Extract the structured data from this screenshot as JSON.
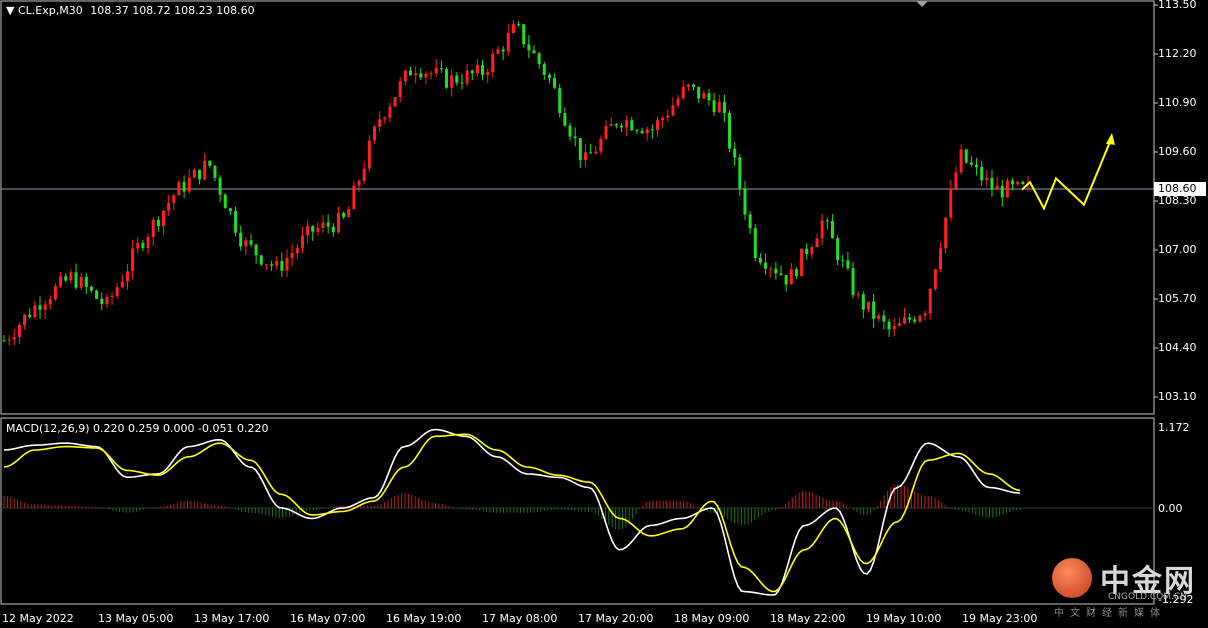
{
  "header": {
    "symbol": "CL.Exp,M30",
    "ohlc": "108.37 108.72 108.23 108.60"
  },
  "price_axis": {
    "ticks": [
      "113.50",
      "112.20",
      "110.90",
      "109.60",
      "108.30",
      "107.00",
      "105.70",
      "104.40",
      "103.10"
    ],
    "current_price": "108.60"
  },
  "macd_panel": {
    "label": "MACD(12,26,9) 0.220 0.259 0.000 -0.051 0.220",
    "ticks": [
      "1.172",
      "0.00",
      "-1.292"
    ]
  },
  "time_axis": {
    "ticks": [
      "12 May 2022",
      "13 May 05:00",
      "13 May 17:00",
      "16 May 07:00",
      "16 May 19:00",
      "17 May 08:00",
      "17 May 20:00",
      "18 May 09:00",
      "18 May 22:00",
      "19 May 10:00",
      "19 May 23:00"
    ]
  },
  "watermark": {
    "brand": "中金网",
    "url": "CNGOLD.COM.CN",
    "slogan": "中文财经新媒体"
  },
  "colors": {
    "up": "#ff2020",
    "down": "#20e020",
    "macd_line": "#ffffff",
    "signal_line": "#ffff00",
    "hist_pos": "#c02020",
    "hist_neg": "#207020",
    "forecast": "#ffff00"
  },
  "chart_data": {
    "type": "candlestick",
    "title": "CL.Exp,M30",
    "ylim": [
      102.8,
      113.6
    ],
    "price_path": [
      {
        "x": "12 May 2022",
        "y": 104.6
      },
      {
        "x": "12 May",
        "y": 105.6
      },
      {
        "x": "12 May",
        "y": 106.3
      },
      {
        "x": "13 May 05:00",
        "y": 105.5
      },
      {
        "x": "13 May",
        "y": 107.2
      },
      {
        "x": "13 May",
        "y": 108.5
      },
      {
        "x": "13 May 17:00",
        "y": 109.3
      },
      {
        "x": "13 May",
        "y": 107.2
      },
      {
        "x": "13 May",
        "y": 106.5
      },
      {
        "x": "16 May 07:00",
        "y": 107.5
      },
      {
        "x": "16 May",
        "y": 107.8
      },
      {
        "x": "16 May",
        "y": 110.5
      },
      {
        "x": "16 May 19:00",
        "y": 111.9
      },
      {
        "x": "16 May",
        "y": 111.5
      },
      {
        "x": "16 May",
        "y": 111.7
      },
      {
        "x": "17 May 08:00",
        "y": 112.9
      },
      {
        "x": "17 May",
        "y": 111.5
      },
      {
        "x": "17 May",
        "y": 109.3
      },
      {
        "x": "17 May 20:00",
        "y": 110.5
      },
      {
        "x": "17 May",
        "y": 110.2
      },
      {
        "x": "17 May",
        "y": 111.3
      },
      {
        "x": "18 May 09:00",
        "y": 110.8
      },
      {
        "x": "18 May",
        "y": 107.0
      },
      {
        "x": "18 May",
        "y": 106.2
      },
      {
        "x": "18 May 22:00",
        "y": 107.8
      },
      {
        "x": "18 May",
        "y": 105.7
      },
      {
        "x": "18 May",
        "y": 104.8
      },
      {
        "x": "19 May 10:00",
        "y": 105.5
      },
      {
        "x": "19 May",
        "y": 109.5
      },
      {
        "x": "19 May",
        "y": 108.6
      },
      {
        "x": "19 May 23:00",
        "y": 108.6
      }
    ],
    "forecast_path": [
      108.6,
      108.8,
      108.1,
      108.9,
      108.2,
      110.0
    ],
    "macd": {
      "ylim": [
        -1.292,
        1.172
      ],
      "macd_line": [
        0.85,
        0.92,
        0.95,
        0.9,
        0.45,
        0.5,
        0.9,
        1.0,
        0.6,
        0.0,
        -0.15,
        0.0,
        0.15,
        0.9,
        1.15,
        1.05,
        0.75,
        0.5,
        0.45,
        0.3,
        -0.6,
        -0.25,
        -0.15,
        0.0,
        -1.2,
        -1.25,
        -0.25,
        0.0,
        -0.95,
        0.3,
        0.95,
        0.75,
        0.3,
        0.22
      ],
      "signal_line": [
        0.6,
        0.85,
        0.9,
        0.88,
        0.55,
        0.48,
        0.75,
        0.95,
        0.7,
        0.2,
        -0.1,
        -0.05,
        0.1,
        0.6,
        1.05,
        1.08,
        0.85,
        0.6,
        0.48,
        0.38,
        -0.15,
        -0.4,
        -0.3,
        0.1,
        -0.85,
        -1.2,
        -0.6,
        -0.15,
        -0.8,
        -0.2,
        0.7,
        0.8,
        0.5,
        0.26
      ]
    }
  }
}
